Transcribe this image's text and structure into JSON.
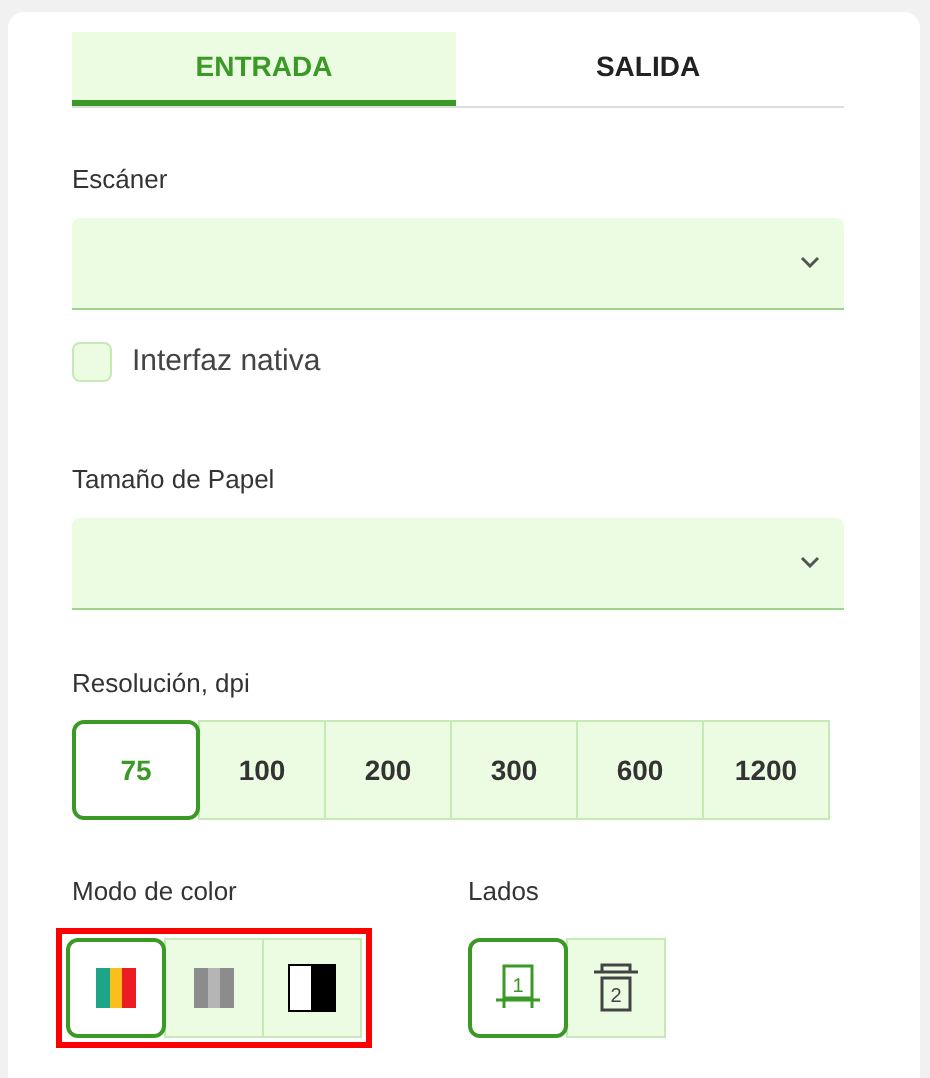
{
  "tabs": [
    {
      "label": "ENTRADA",
      "selected": true
    },
    {
      "label": "SALIDA",
      "selected": false
    }
  ],
  "scanner": {
    "label": "Escáner"
  },
  "native_interface": {
    "label": "Interfaz nativa",
    "checked": false
  },
  "paper_size": {
    "label": "Tamaño de Papel"
  },
  "resolution": {
    "label": "Resolución, dpi",
    "options": [
      {
        "label": "75",
        "selected": true
      },
      {
        "label": "100",
        "selected": false
      },
      {
        "label": "200",
        "selected": false
      },
      {
        "label": "300",
        "selected": false
      },
      {
        "label": "600",
        "selected": false
      },
      {
        "label": "1200",
        "selected": false
      }
    ]
  },
  "color_mode": {
    "label": "Modo de color",
    "highlighted": true,
    "options": [
      {
        "kind": "color",
        "selected": true
      },
      {
        "kind": "gray",
        "selected": false
      },
      {
        "kind": "bw",
        "selected": false
      }
    ]
  },
  "sides": {
    "label": "Lados",
    "options": [
      {
        "kind": "single",
        "number": "1",
        "selected": true
      },
      {
        "kind": "double",
        "number": "2",
        "selected": false
      }
    ]
  }
}
